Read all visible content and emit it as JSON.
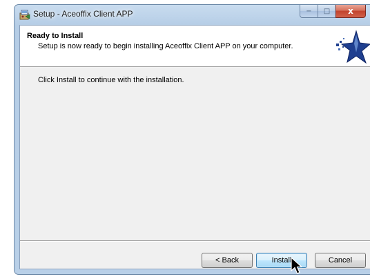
{
  "window": {
    "title": "Setup - Aceoffix Client APP",
    "icon": "setup-installer-icon",
    "caption_buttons": {
      "minimize": "−",
      "maximize": "□",
      "close": "x"
    }
  },
  "header": {
    "title": "Ready to Install",
    "subtitle": "Setup is now ready to begin installing Aceoffix Client APP on your computer.",
    "logo": "star-logo-icon"
  },
  "main": {
    "instruction": "Click Install to continue with the installation."
  },
  "footer": {
    "back_label": "< Back",
    "install_label": "Install",
    "cancel_label": "Cancel"
  },
  "colors": {
    "frame": "#b9d0e8",
    "close_button": "#c2432d",
    "default_button": "#3c7fb1",
    "logo_blue": "#1f3f8f"
  }
}
